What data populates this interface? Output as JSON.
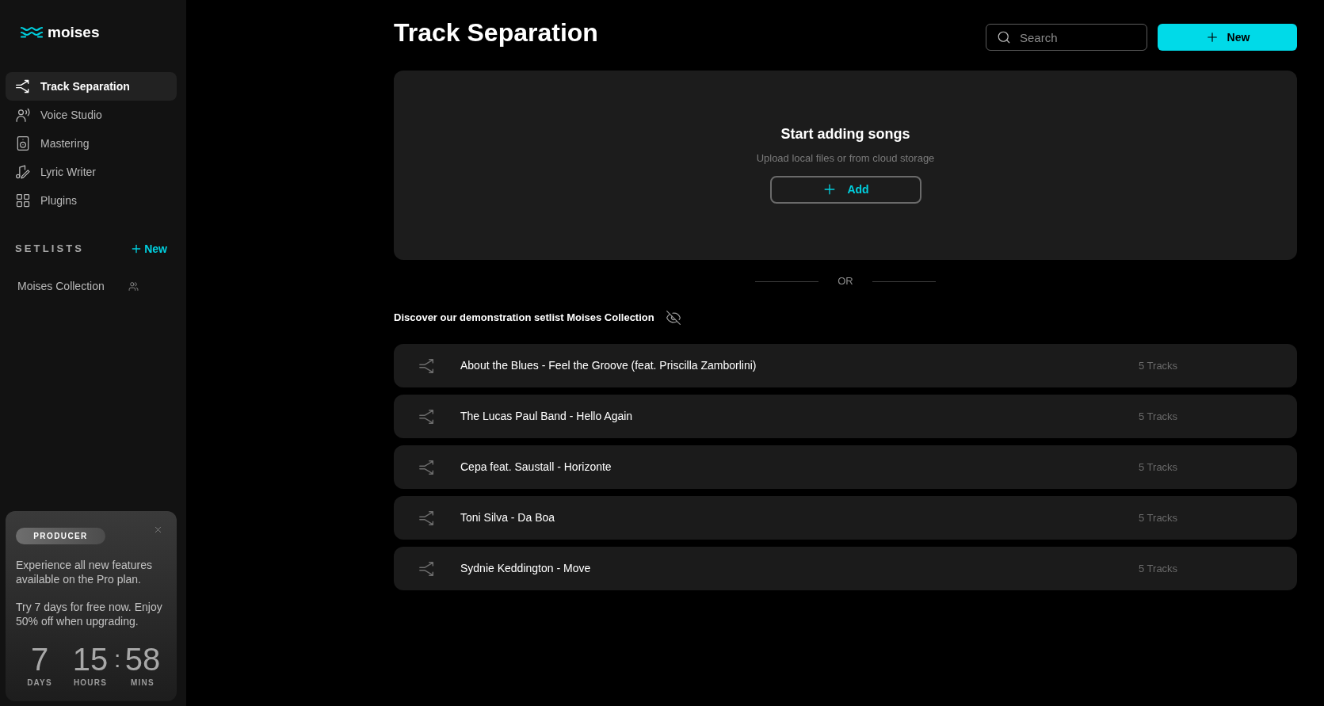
{
  "sidebar": {
    "logo": {
      "text": "moises"
    },
    "nav": [
      {
        "label": "Track Separation",
        "selected": true
      },
      {
        "label": "Voice Studio",
        "selected": false
      },
      {
        "label": "Mastering",
        "selected": false
      },
      {
        "label": "Lyric Writer",
        "selected": false
      },
      {
        "label": "Plugins",
        "selected": false
      }
    ],
    "setlists": {
      "heading": "SETLISTS",
      "new_button": "New",
      "items": [
        {
          "label": "Moises Collection"
        }
      ]
    },
    "promo": {
      "badge": "PRODUCER",
      "paragraphs": [
        "Experience all new features available on the Pro plan.",
        "Try 7 days for free now. Enjoy 50% off when upgrading."
      ],
      "countdown": [
        {
          "value": "7",
          "unit": "DAYS"
        },
        {
          "value": "15",
          "unit": "HOURS"
        },
        {
          "value": "58",
          "unit": "MINS"
        }
      ],
      "separator": ":"
    }
  },
  "header": {
    "title": "Track Separation",
    "search": {
      "placeholder": "Search"
    },
    "new_button": "New"
  },
  "upload": {
    "title": "Start adding songs",
    "subtitle": "Upload local files or from cloud storage",
    "add_button": "Add"
  },
  "divider": "OR",
  "demo": {
    "text": "Discover our demonstration setlist **Moises Collection**",
    "rows": [
      {
        "title": "About the Blues - Feel the Groove (feat. Priscilla Zamborlini)",
        "count": "5 Tracks"
      },
      {
        "title": "The Lucas Paul Band - Hello Again",
        "count": "5 Tracks"
      },
      {
        "title": "Cepa feat. Saustall - Horizonte",
        "count": "5 Tracks"
      },
      {
        "title": "Toni Silva - Da Boa",
        "count": "5 Tracks"
      },
      {
        "title": "Sydnie Keddington - Move",
        "count": "5 Tracks"
      }
    ]
  }
}
